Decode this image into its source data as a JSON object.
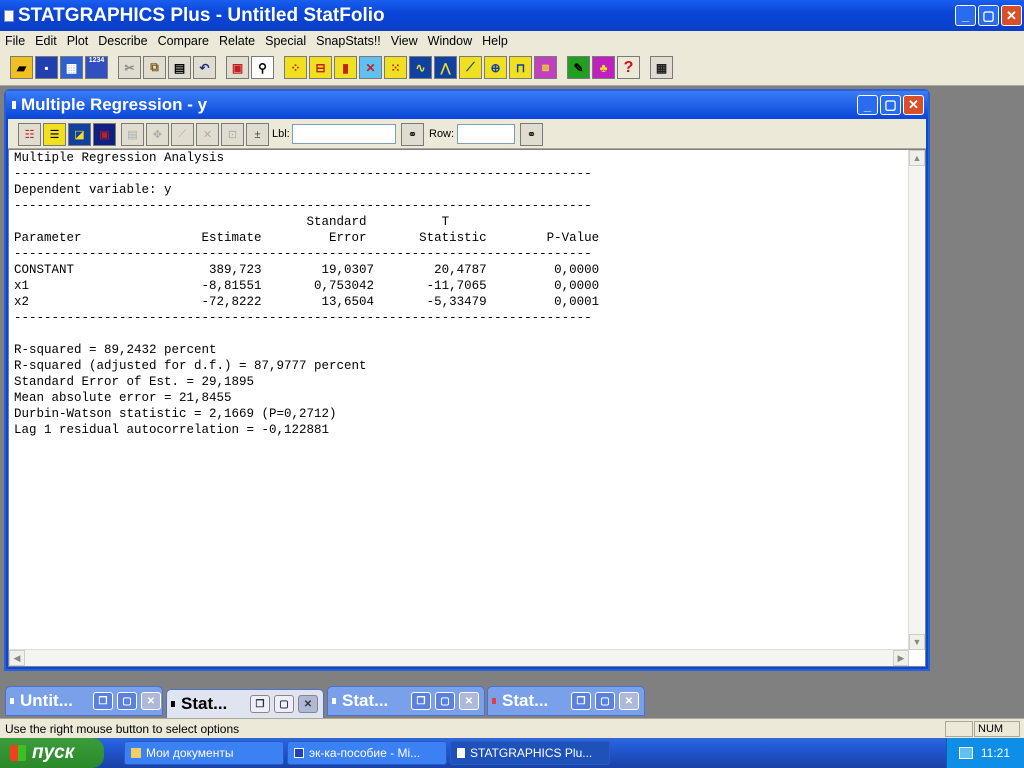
{
  "app": {
    "title": "STATGRAPHICS Plus - Untitled StatFolio"
  },
  "menu": [
    "File",
    "Edit",
    "Plot",
    "Describe",
    "Compare",
    "Relate",
    "Special",
    "SnapStats!!",
    "View",
    "Window",
    "Help"
  ],
  "toolbar": {
    "icon_label_1234": "1234"
  },
  "child_window": {
    "title": "Multiple Regression - y",
    "lbl_label": "Lbl:",
    "row_label": "Row:",
    "lbl_value": "",
    "row_value": ""
  },
  "output": {
    "line_01": "Multiple Regression Analysis",
    "line_02": "-----------------------------------------------------------------------------",
    "line_03": "Dependent variable: y",
    "line_04": "-----------------------------------------------------------------------------",
    "line_05": "                                       Standard          T",
    "line_06": "Parameter                Estimate         Error       Statistic        P-Value",
    "line_07": "-----------------------------------------------------------------------------",
    "line_08": "CONSTANT                  389,723        19,0307        20,4787         0,0000",
    "line_09": "x1                       -8,81551       0,753042       -11,7065         0,0000",
    "line_10": "x2                       -72,8222        13,6504       -5,33479         0,0001",
    "line_11": "-----------------------------------------------------------------------------",
    "line_12": "R-squared = 89,2432 percent",
    "line_13": "R-squared (adjusted for d.f.) = 87,9777 percent",
    "line_14": "Standard Error of Est. = 29,1895",
    "line_15": "Mean absolute error = 21,8455",
    "line_16": "Durbin-Watson statistic = 2,1669 (P=0,2712)",
    "line_17": "Lag 1 residual autocorrelation = -0,122881"
  },
  "minimized_windows": [
    "Untit...",
    "Stat...",
    "Stat...",
    "Stat..."
  ],
  "status": {
    "text": "Use the right mouse button to select options",
    "num": "NUM"
  },
  "taskbar": {
    "start": "пуск",
    "tasks": [
      "Мои документы",
      "эк-ка-пособие - Mi...",
      "STATGRAPHICS Plu..."
    ],
    "clock": "11:21"
  },
  "colors": {
    "xp_blue": "#0a46d8",
    "toolbar_bg": "#ece9d8",
    "desktop_gray": "#808080"
  }
}
